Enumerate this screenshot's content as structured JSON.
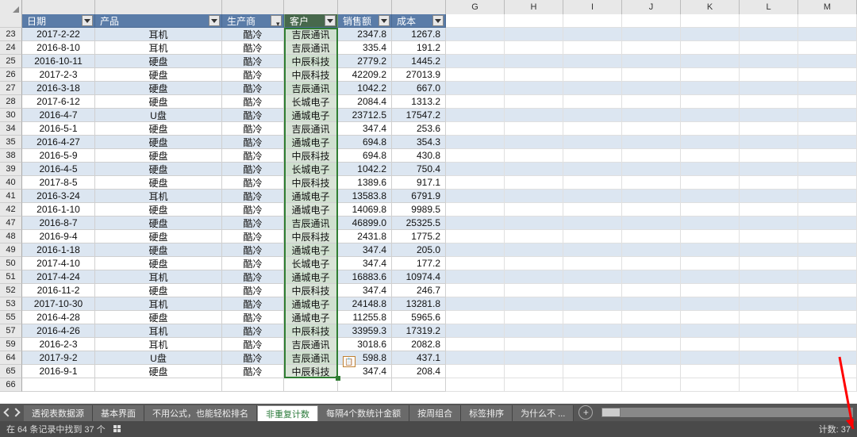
{
  "column_letters": [
    "G",
    "H",
    "I",
    "J",
    "K",
    "L",
    "M"
  ],
  "col_widths": {
    "rownum": 28,
    "date": 92,
    "product": 160,
    "maker": 78,
    "customer": 68,
    "sales": 68,
    "cost": 68,
    "empty": 74
  },
  "headers": {
    "date": "日期",
    "product": "产品",
    "maker": "生产商",
    "customer": "客户",
    "sales": "销售额",
    "cost": "成本"
  },
  "rows": [
    {
      "n": 23,
      "date": "2017-2-22",
      "product": "耳机",
      "maker": "酷冷",
      "customer": "吉辰通讯",
      "sales": "2347.8",
      "cost": "1267.8",
      "alt": true
    },
    {
      "n": 24,
      "date": "2016-8-10",
      "product": "耳机",
      "maker": "酷冷",
      "customer": "吉辰通讯",
      "sales": "335.4",
      "cost": "191.2",
      "alt": false
    },
    {
      "n": 25,
      "date": "2016-10-11",
      "product": "硬盘",
      "maker": "酷冷",
      "customer": "中辰科技",
      "sales": "2779.2",
      "cost": "1445.2",
      "alt": true
    },
    {
      "n": 26,
      "date": "2017-2-3",
      "product": "硬盘",
      "maker": "酷冷",
      "customer": "中辰科技",
      "sales": "42209.2",
      "cost": "27013.9",
      "alt": false
    },
    {
      "n": 27,
      "date": "2016-3-18",
      "product": "硬盘",
      "maker": "酷冷",
      "customer": "吉辰通讯",
      "sales": "1042.2",
      "cost": "667.0",
      "alt": true
    },
    {
      "n": 28,
      "date": "2017-6-12",
      "product": "硬盘",
      "maker": "酷冷",
      "customer": "长城电子",
      "sales": "2084.4",
      "cost": "1313.2",
      "alt": false
    },
    {
      "n": 30,
      "date": "2016-4-7",
      "product": "U盘",
      "maker": "酷冷",
      "customer": "通城电子",
      "sales": "23712.5",
      "cost": "17547.2",
      "alt": true
    },
    {
      "n": 34,
      "date": "2016-5-1",
      "product": "硬盘",
      "maker": "酷冷",
      "customer": "吉辰通讯",
      "sales": "347.4",
      "cost": "253.6",
      "alt": false
    },
    {
      "n": 35,
      "date": "2016-4-27",
      "product": "硬盘",
      "maker": "酷冷",
      "customer": "通城电子",
      "sales": "694.8",
      "cost": "354.3",
      "alt": true
    },
    {
      "n": 38,
      "date": "2016-5-9",
      "product": "硬盘",
      "maker": "酷冷",
      "customer": "中辰科技",
      "sales": "694.8",
      "cost": "430.8",
      "alt": false
    },
    {
      "n": 39,
      "date": "2016-4-5",
      "product": "硬盘",
      "maker": "酷冷",
      "customer": "长城电子",
      "sales": "1042.2",
      "cost": "750.4",
      "alt": true
    },
    {
      "n": 40,
      "date": "2017-8-5",
      "product": "硬盘",
      "maker": "酷冷",
      "customer": "中辰科技",
      "sales": "1389.6",
      "cost": "917.1",
      "alt": false
    },
    {
      "n": 41,
      "date": "2016-3-24",
      "product": "耳机",
      "maker": "酷冷",
      "customer": "通城电子",
      "sales": "13583.8",
      "cost": "6791.9",
      "alt": true
    },
    {
      "n": 42,
      "date": "2016-1-10",
      "product": "硬盘",
      "maker": "酷冷",
      "customer": "通城电子",
      "sales": "14069.8",
      "cost": "9989.5",
      "alt": false
    },
    {
      "n": 47,
      "date": "2016-8-7",
      "product": "硬盘",
      "maker": "酷冷",
      "customer": "吉辰通讯",
      "sales": "46899.0",
      "cost": "25325.5",
      "alt": true
    },
    {
      "n": 48,
      "date": "2016-9-4",
      "product": "硬盘",
      "maker": "酷冷",
      "customer": "中辰科技",
      "sales": "2431.8",
      "cost": "1775.2",
      "alt": false
    },
    {
      "n": 49,
      "date": "2016-1-18",
      "product": "硬盘",
      "maker": "酷冷",
      "customer": "通城电子",
      "sales": "347.4",
      "cost": "205.0",
      "alt": true
    },
    {
      "n": 50,
      "date": "2017-4-10",
      "product": "硬盘",
      "maker": "酷冷",
      "customer": "长城电子",
      "sales": "347.4",
      "cost": "177.2",
      "alt": false
    },
    {
      "n": 51,
      "date": "2017-4-24",
      "product": "耳机",
      "maker": "酷冷",
      "customer": "通城电子",
      "sales": "16883.6",
      "cost": "10974.4",
      "alt": true
    },
    {
      "n": 52,
      "date": "2016-11-2",
      "product": "硬盘",
      "maker": "酷冷",
      "customer": "中辰科技",
      "sales": "347.4",
      "cost": "246.7",
      "alt": false
    },
    {
      "n": 53,
      "date": "2017-10-30",
      "product": "耳机",
      "maker": "酷冷",
      "customer": "通城电子",
      "sales": "24148.8",
      "cost": "13281.8",
      "alt": true
    },
    {
      "n": 55,
      "date": "2016-4-28",
      "product": "硬盘",
      "maker": "酷冷",
      "customer": "通城电子",
      "sales": "11255.8",
      "cost": "5965.6",
      "alt": false
    },
    {
      "n": 57,
      "date": "2016-4-26",
      "product": "耳机",
      "maker": "酷冷",
      "customer": "中辰科技",
      "sales": "33959.3",
      "cost": "17319.2",
      "alt": true
    },
    {
      "n": 59,
      "date": "2016-2-3",
      "product": "耳机",
      "maker": "酷冷",
      "customer": "吉辰通讯",
      "sales": "3018.6",
      "cost": "2082.8",
      "alt": false
    },
    {
      "n": 64,
      "date": "2017-9-2",
      "product": "U盘",
      "maker": "酷冷",
      "customer": "吉辰通讯",
      "sales": "598.8",
      "cost": "437.1",
      "alt": true
    },
    {
      "n": 65,
      "date": "2016-9-1",
      "product": "硬盘",
      "maker": "酷冷",
      "customer": "中辰科技",
      "sales": "347.4",
      "cost": "208.4",
      "alt": false
    }
  ],
  "trailing_rownum": 66,
  "tabs": {
    "items": [
      "透视表数据源",
      "基本界面",
      "不用公式，也能轻松排名",
      "非重复计数",
      "每隔4个数统计金额",
      "按周组合",
      "标签排序",
      "为什么不 ..."
    ],
    "active_index": 3,
    "add_label": "+"
  },
  "status": {
    "left": "在 64 条记录中找到 37 个",
    "right": "计数: 37"
  }
}
